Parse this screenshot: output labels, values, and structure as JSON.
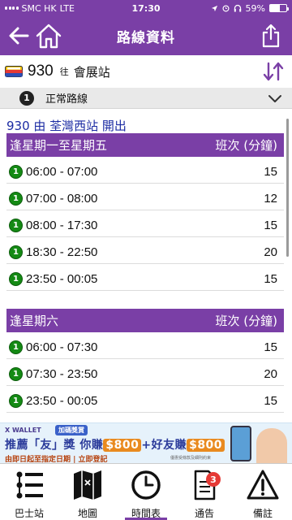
{
  "status_bar": {
    "carrier": "SMC HK",
    "network": "LTE",
    "time": "17:30",
    "battery": "59%",
    "battery_level": 0.59
  },
  "nav": {
    "title": "路線資料"
  },
  "route": {
    "number": "930",
    "to_label": "往",
    "destination": "會展站"
  },
  "variant": {
    "number": "1",
    "label": "正常路線"
  },
  "timetable": {
    "departure_text": "930 由 荃灣西站 開出",
    "sections": [
      {
        "title": "逢星期一至星期五",
        "freq_header": "班次 (分鐘)",
        "rows": [
          {
            "badge": "1",
            "time": "06:00 - 07:00",
            "freq": "15"
          },
          {
            "badge": "1",
            "time": "07:00 - 08:00",
            "freq": "12"
          },
          {
            "badge": "1",
            "time": "08:00 - 17:30",
            "freq": "15"
          },
          {
            "badge": "1",
            "time": "18:30 - 22:50",
            "freq": "20"
          },
          {
            "badge": "1",
            "time": "23:50 - 00:05",
            "freq": "15"
          }
        ]
      },
      {
        "title": "逢星期六",
        "freq_header": "班次 (分鐘)",
        "rows": [
          {
            "badge": "1",
            "time": "06:00 - 07:30",
            "freq": "15"
          },
          {
            "badge": "1",
            "time": "07:30 - 23:50",
            "freq": "20"
          },
          {
            "badge": "1",
            "time": "23:50 - 00:05",
            "freq": "15"
          }
        ]
      }
    ]
  },
  "banner": {
    "logo": "X WALLET",
    "tag": "加碼獎賞",
    "headline_a": "推薦「友」獎 你賺",
    "amount_a": "$800",
    "headline_b": "+好友賺",
    "amount_b": "$800",
    "sub": "由即日起至指定日期 | 立即登記",
    "fine_print": "優惠受條款及細則約束"
  },
  "tabs": [
    {
      "label": "巴士站",
      "icon": "bus-stop-icon"
    },
    {
      "label": "地圖",
      "icon": "map-icon"
    },
    {
      "label": "時間表",
      "icon": "clock-icon",
      "active": true
    },
    {
      "label": "通告",
      "icon": "notice-icon",
      "badge": "3"
    },
    {
      "label": "備註",
      "icon": "warning-icon"
    }
  ],
  "colors": {
    "brand_purple": "#7a3fa6",
    "route_badge_green": "#148a14",
    "departure_blue": "#1b2ba3",
    "notification_red": "#e53935"
  }
}
